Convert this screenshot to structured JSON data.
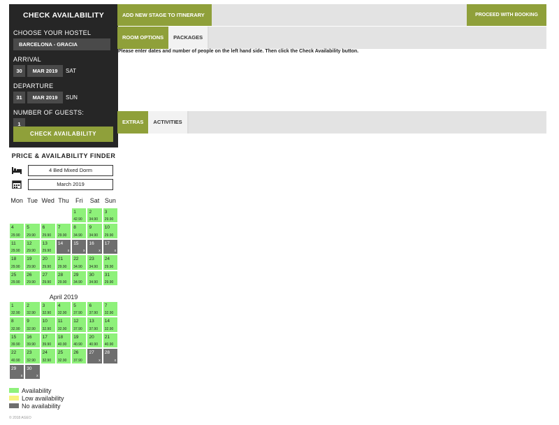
{
  "panel": {
    "title": "CHECK AVAILABILITY",
    "hostel_label": "CHOOSE YOUR HOSTEL",
    "hostel_value": "BARCELONA - GRACIA",
    "arrival_label": "ARRIVAL",
    "arrival": {
      "day": "30",
      "month": "MAR 2019",
      "dow": "SAT"
    },
    "departure_label": "DEPARTURE",
    "departure": {
      "day": "31",
      "month": "MAR 2019",
      "dow": "SUN"
    },
    "guests_label": "NUMBER OF GUESTS:",
    "guests_value": "1",
    "check_button": "CHECK AVAILABILITY"
  },
  "finder": {
    "title": "PRICE & AVAILABILITY FINDER",
    "room_value": "4 Bed Mixed Dorm",
    "month_value": "March 2019",
    "bed_icon": "bed-icon",
    "calendar_icon": "calendar-icon",
    "weekdays": [
      "Mon",
      "Tue",
      "Wed",
      "Thu",
      "Fri",
      "Sat",
      "Sun"
    ],
    "march": {
      "offset": 4,
      "days": [
        {
          "d": "1",
          "p": "42.90",
          "s": "av"
        },
        {
          "d": "2",
          "p": "34.90",
          "s": "av"
        },
        {
          "d": "3",
          "p": "29.90",
          "s": "av"
        },
        {
          "d": "4",
          "p": "29.90",
          "s": "av"
        },
        {
          "d": "5",
          "p": "29.90",
          "s": "av"
        },
        {
          "d": "6",
          "p": "29.90",
          "s": "av"
        },
        {
          "d": "7",
          "p": "29.90",
          "s": "av"
        },
        {
          "d": "8",
          "p": "34.90",
          "s": "av"
        },
        {
          "d": "9",
          "p": "34.90",
          "s": "av"
        },
        {
          "d": "10",
          "p": "29.90",
          "s": "av"
        },
        {
          "d": "11",
          "p": "29.90",
          "s": "av"
        },
        {
          "d": "12",
          "p": "29.90",
          "s": "av"
        },
        {
          "d": "13",
          "p": "29.90",
          "s": "av"
        },
        {
          "d": "14",
          "p": "x",
          "s": "na"
        },
        {
          "d": "15",
          "p": "x",
          "s": "na"
        },
        {
          "d": "16",
          "p": "x",
          "s": "na"
        },
        {
          "d": "17",
          "p": "x",
          "s": "na"
        },
        {
          "d": "18",
          "p": "29.90",
          "s": "av"
        },
        {
          "d": "19",
          "p": "29.90",
          "s": "av"
        },
        {
          "d": "20",
          "p": "29.90",
          "s": "av"
        },
        {
          "d": "21",
          "p": "29.90",
          "s": "av"
        },
        {
          "d": "22",
          "p": "34.90",
          "s": "av"
        },
        {
          "d": "23",
          "p": "34.90",
          "s": "av"
        },
        {
          "d": "24",
          "p": "29.90",
          "s": "av"
        },
        {
          "d": "25",
          "p": "29.90",
          "s": "av"
        },
        {
          "d": "26",
          "p": "29.90",
          "s": "av"
        },
        {
          "d": "27",
          "p": "29.90",
          "s": "av"
        },
        {
          "d": "28",
          "p": "29.90",
          "s": "av"
        },
        {
          "d": "29",
          "p": "34.90",
          "s": "av"
        },
        {
          "d": "30",
          "p": "34.90",
          "s": "av"
        },
        {
          "d": "31",
          "p": "29.90",
          "s": "av"
        }
      ]
    },
    "april_title": "April 2019",
    "april": {
      "offset": 0,
      "days": [
        {
          "d": "1",
          "p": "32.90",
          "s": "av"
        },
        {
          "d": "2",
          "p": "32.90",
          "s": "av"
        },
        {
          "d": "3",
          "p": "32.90",
          "s": "av"
        },
        {
          "d": "4",
          "p": "32.90",
          "s": "av"
        },
        {
          "d": "5",
          "p": "37.90",
          "s": "av"
        },
        {
          "d": "6",
          "p": "37.90",
          "s": "av"
        },
        {
          "d": "7",
          "p": "32.90",
          "s": "av"
        },
        {
          "d": "8",
          "p": "32.90",
          "s": "av"
        },
        {
          "d": "9",
          "p": "32.90",
          "s": "av"
        },
        {
          "d": "10",
          "p": "32.90",
          "s": "av"
        },
        {
          "d": "11",
          "p": "32.90",
          "s": "av"
        },
        {
          "d": "12",
          "p": "37.90",
          "s": "av"
        },
        {
          "d": "13",
          "p": "37.90",
          "s": "av"
        },
        {
          "d": "14",
          "p": "32.90",
          "s": "av"
        },
        {
          "d": "15",
          "p": "39.90",
          "s": "av"
        },
        {
          "d": "16",
          "p": "39.90",
          "s": "av"
        },
        {
          "d": "17",
          "p": "39.90",
          "s": "av"
        },
        {
          "d": "18",
          "p": "40.90",
          "s": "av"
        },
        {
          "d": "19",
          "p": "40.90",
          "s": "av"
        },
        {
          "d": "20",
          "p": "40.90",
          "s": "av"
        },
        {
          "d": "21",
          "p": "40.90",
          "s": "av"
        },
        {
          "d": "22",
          "p": "40.90",
          "s": "av"
        },
        {
          "d": "23",
          "p": "32.90",
          "s": "av"
        },
        {
          "d": "24",
          "p": "32.90",
          "s": "av"
        },
        {
          "d": "25",
          "p": "32.90",
          "s": "av"
        },
        {
          "d": "26",
          "p": "37.90",
          "s": "av"
        },
        {
          "d": "27",
          "p": "x",
          "s": "na"
        },
        {
          "d": "28",
          "p": "x",
          "s": "na"
        },
        {
          "d": "29",
          "p": "x",
          "s": "na"
        },
        {
          "d": "30",
          "p": "x",
          "s": "na"
        }
      ]
    }
  },
  "legend": [
    {
      "label": "Availability",
      "color": "#8ef17a"
    },
    {
      "label": "Low availability",
      "color": "#f6f37e"
    },
    {
      "label": "No availability",
      "color": "#6e6e6e"
    }
  ],
  "copyright": "© 2018 AGEO",
  "topbar": {
    "add_stage": "ADD NEW STAGE TO ITINERARY",
    "proceed": "PROCEED WITH BOOKING"
  },
  "room_tabs": [
    "ROOM OPTIONS",
    "PACKAGES"
  ],
  "notice": "Please enter dates and number of people on the left hand side. Then click the Check Availability button.",
  "extra_tabs": [
    "EXTRAS",
    "ACTIVITIES"
  ],
  "colors": {
    "accent": "#8fa03a",
    "panel_bg": "#262626",
    "available": "#8ef17a",
    "low": "#f6f37e",
    "none": "#6e6e6e"
  }
}
